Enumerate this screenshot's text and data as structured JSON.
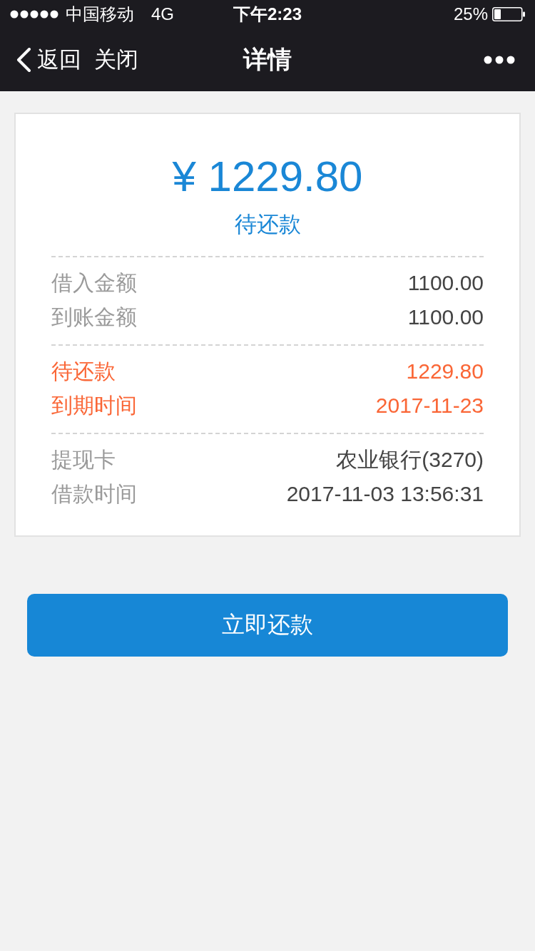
{
  "status_bar": {
    "carrier": "中国移动",
    "network": "4G",
    "time": "下午2:23",
    "battery": "25%"
  },
  "nav_bar": {
    "back": "返回",
    "close": "关闭",
    "title": "详情"
  },
  "summary": {
    "amount": "¥ 1229.80",
    "status": "待还款"
  },
  "sections": [
    {
      "rows": [
        {
          "label": "借入金额",
          "value": "1100.00",
          "highlighted": false
        },
        {
          "label": "到账金额",
          "value": "1100.00",
          "highlighted": false
        }
      ]
    },
    {
      "rows": [
        {
          "label": "待还款",
          "value": "1229.80",
          "highlighted": true
        },
        {
          "label": "到期时间",
          "value": "2017-11-23",
          "highlighted": true
        }
      ]
    },
    {
      "rows": [
        {
          "label": "提现卡",
          "value": "农业银行(3270)",
          "highlighted": false
        },
        {
          "label": "借款时间",
          "value": "2017-11-03 13:56:31",
          "highlighted": false
        }
      ]
    }
  ],
  "button": "立即还款"
}
